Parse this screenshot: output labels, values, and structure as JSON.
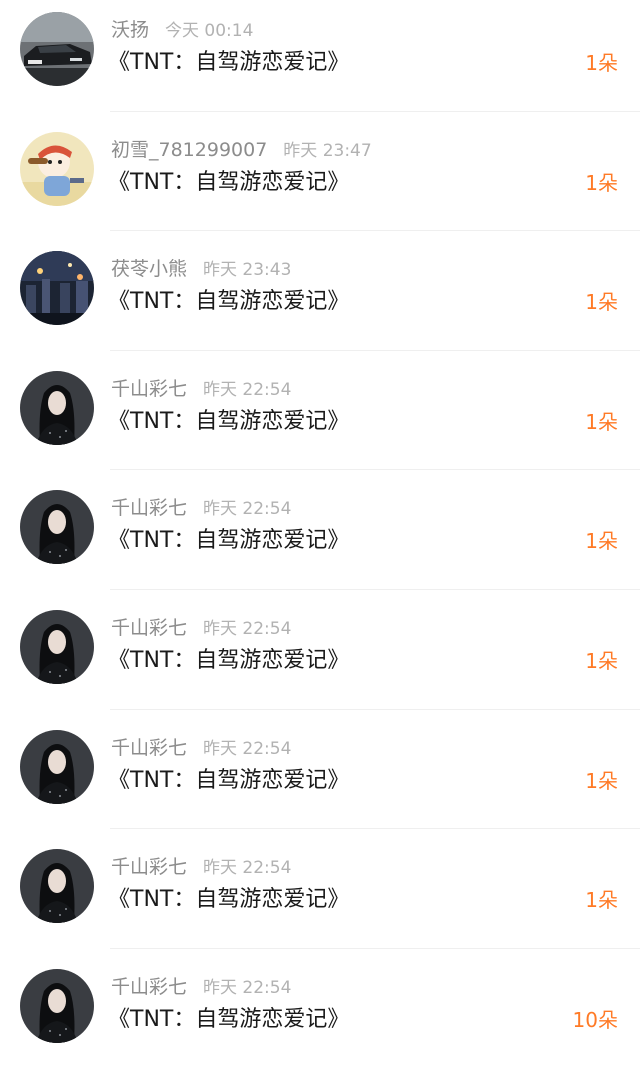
{
  "gift_list": {
    "items": [
      {
        "username": "沃扬",
        "time": "今天 00:14",
        "title": "《TNT：自驾游恋爱记》",
        "count": "1朵",
        "avatar": "car"
      },
      {
        "username": "初雪_781299007",
        "time": "昨天 23:47",
        "title": "《TNT：自驾游恋爱记》",
        "count": "1朵",
        "avatar": "cartoon"
      },
      {
        "username": "茯苓小熊",
        "time": "昨天 23:43",
        "title": "《TNT：自驾游恋爱记》",
        "count": "1朵",
        "avatar": "night-city"
      },
      {
        "username": "千山彩七",
        "time": "昨天 22:54",
        "title": "《TNT：自驾游恋爱记》",
        "count": "1朵",
        "avatar": "dark-portrait"
      },
      {
        "username": "千山彩七",
        "time": "昨天 22:54",
        "title": "《TNT：自驾游恋爱记》",
        "count": "1朵",
        "avatar": "dark-portrait"
      },
      {
        "username": "千山彩七",
        "time": "昨天 22:54",
        "title": "《TNT：自驾游恋爱记》",
        "count": "1朵",
        "avatar": "dark-portrait"
      },
      {
        "username": "千山彩七",
        "time": "昨天 22:54",
        "title": "《TNT：自驾游恋爱记》",
        "count": "1朵",
        "avatar": "dark-portrait"
      },
      {
        "username": "千山彩七",
        "time": "昨天 22:54",
        "title": "《TNT：自驾游恋爱记》",
        "count": "1朵",
        "avatar": "dark-portrait"
      },
      {
        "username": "千山彩七",
        "time": "昨天 22:54",
        "title": "《TNT：自驾游恋爱记》",
        "count": "10朵",
        "avatar": "dark-portrait"
      }
    ]
  },
  "colors": {
    "accent_count": "#ff7a26",
    "username": "#8c8c8c",
    "time": "#b2b2b2",
    "title": "#1a1a1a",
    "divider": "#efefef"
  }
}
